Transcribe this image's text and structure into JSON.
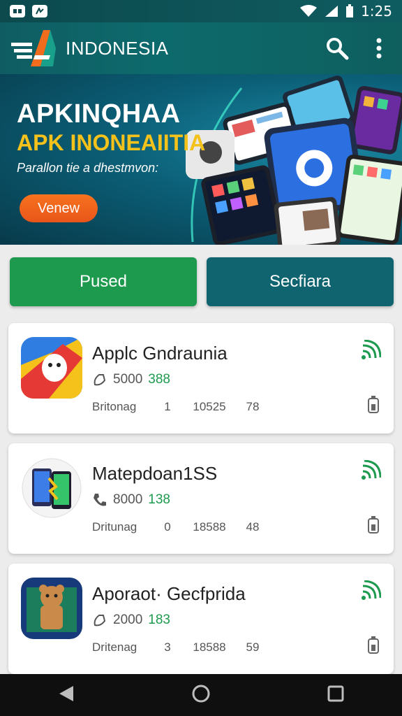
{
  "status_bar": {
    "time": "1:25"
  },
  "app_bar": {
    "title": "INDONESIA"
  },
  "hero": {
    "title": "APKINQHAA",
    "subtitle": "APK INONEAIITIA",
    "description": "Parallon tie a dhestmvon:",
    "button_label": "Venew"
  },
  "actions": {
    "left_label": "Pused",
    "right_label": "Secfiara"
  },
  "cards": [
    {
      "name": "Applc Gndraunia",
      "meta_count": "5000",
      "meta_value": "388",
      "stat_label": "Britonag",
      "stat_1": "1",
      "stat_2": "10525",
      "stat_3": "78"
    },
    {
      "name": "Matepdoan1SS",
      "meta_count": "8000",
      "meta_value": "138",
      "stat_label": "Dritunag",
      "stat_1": "0",
      "stat_2": "18588",
      "stat_3": "48"
    },
    {
      "name": "Aporaot· Gecfprida",
      "meta_count": "2000",
      "meta_value": "183",
      "stat_label": "Dritenag",
      "stat_1": "3",
      "stat_2": "18588",
      "stat_3": "59"
    }
  ],
  "colors": {
    "primary_teal": "#0f6470",
    "accent_green": "#1e9a4e",
    "hero_orange": "#f26c1e",
    "hero_yellow": "#f4c21b"
  },
  "icons": [
    "search-icon",
    "more-vert-icon",
    "wifi-icon",
    "signal-icon",
    "battery-icon",
    "back-icon",
    "home-icon",
    "recents-icon"
  ]
}
